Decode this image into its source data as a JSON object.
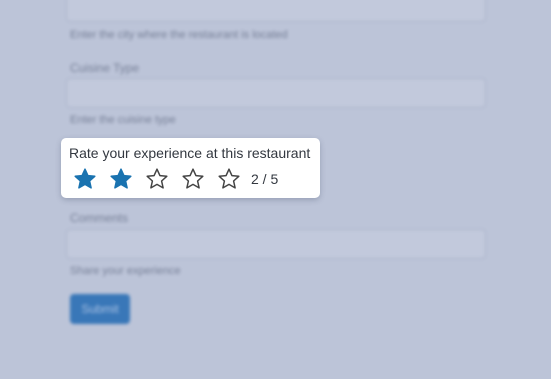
{
  "background_form": {
    "city_hint": "Enter the city where the restaurant is located",
    "cuisine_label": "Cuisine Type",
    "cuisine_hint": "Enter the cuisine type",
    "comments_label": "Comments",
    "comments_hint": "Share your experience",
    "submit_label": "Submit"
  },
  "rating": {
    "prompt": "Rate your experience at this restaurant",
    "max": 5,
    "value": 2,
    "value_text": "2 / 5",
    "filled_color": "#1a73b0",
    "empty_color": "#444444"
  }
}
